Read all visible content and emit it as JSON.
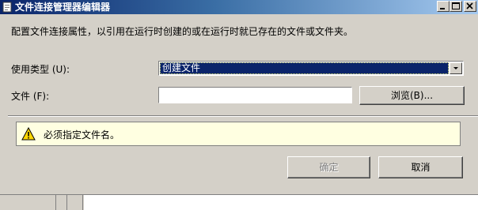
{
  "window": {
    "title": "文件连接管理器编辑器"
  },
  "description": "配置文件连接属性，以引用在运行时创建的或在运行时就已存在的文件或文件夹。",
  "form": {
    "usage_type_label": "使用类型 (U):",
    "usage_type_value": "创建文件",
    "file_label": "文件 (F):",
    "file_value": "",
    "browse_label": "浏览(B)..."
  },
  "message": {
    "text": "必须指定文件名。"
  },
  "buttons": {
    "ok_label": "确定",
    "cancel_label": "取消"
  },
  "colors": {
    "titlebar_start": "#0a246a",
    "selection": "#0a246a",
    "message_background": "#ffffe1",
    "dialog_face": "#d4d0c8"
  },
  "icons": {
    "title": "window-icon",
    "message": "warning-icon",
    "combo": "chevron-down-icon"
  }
}
